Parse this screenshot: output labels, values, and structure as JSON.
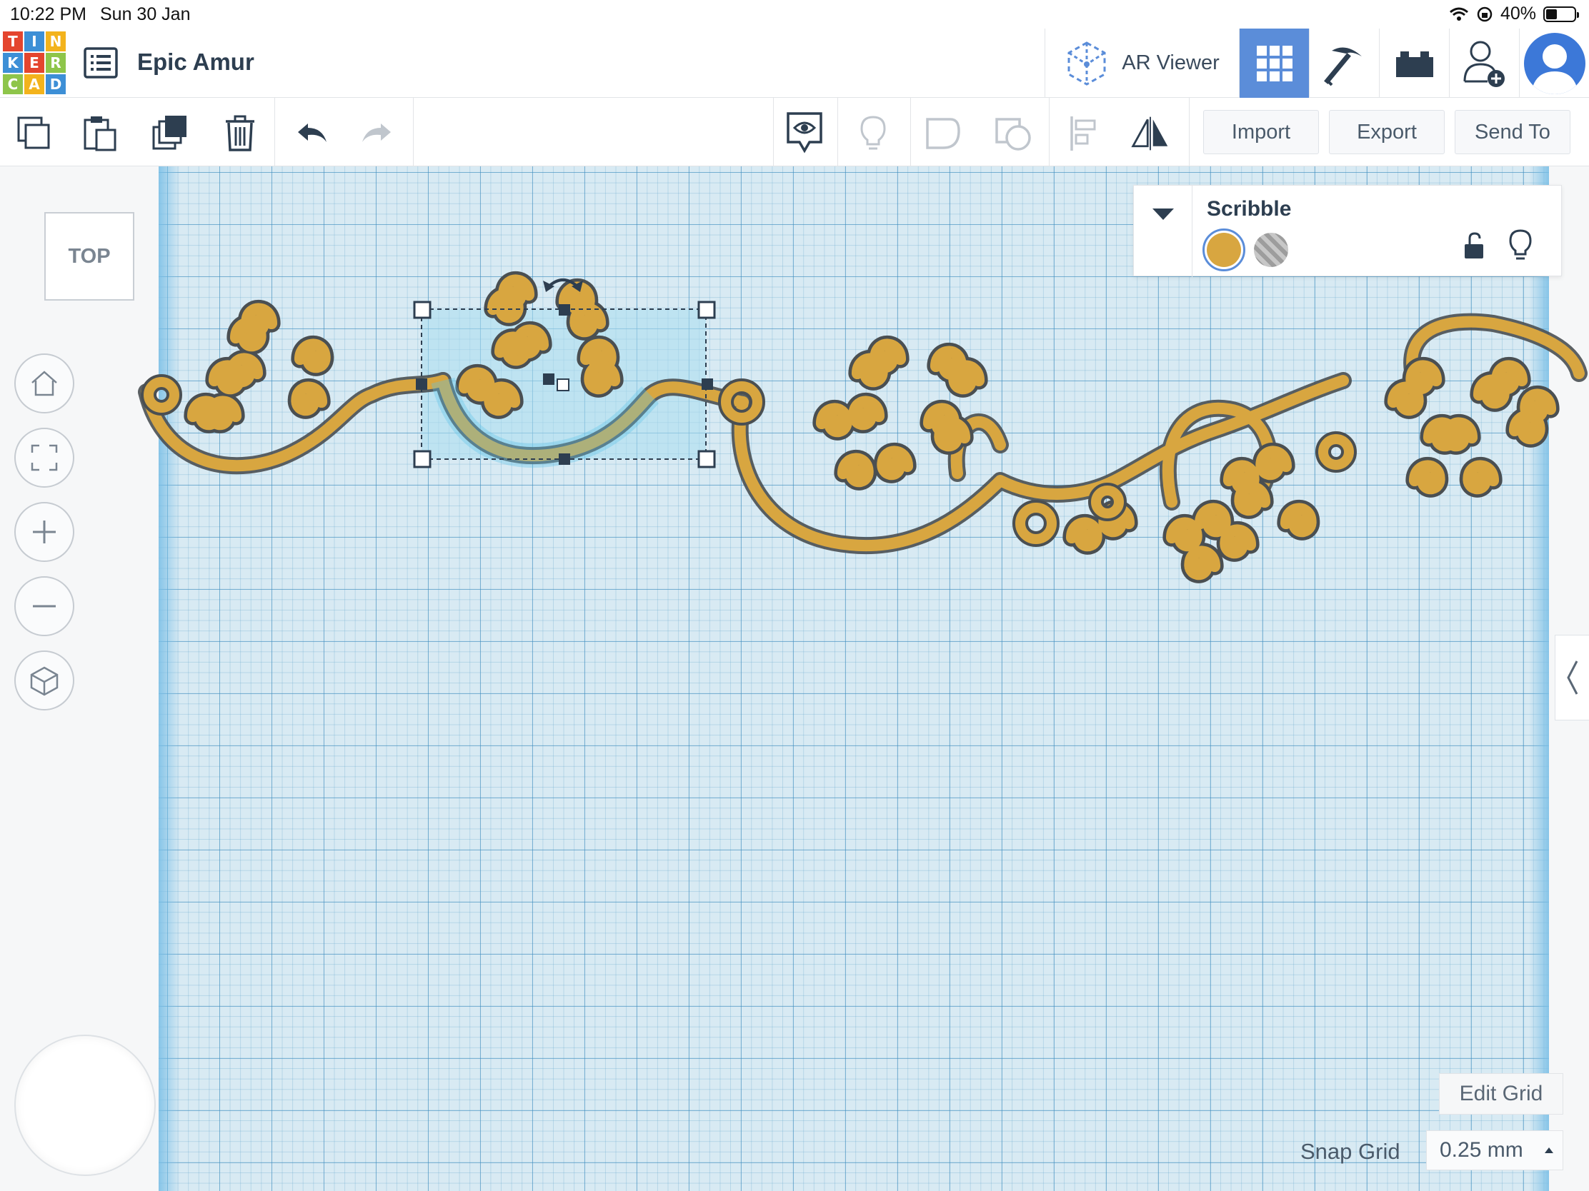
{
  "status_bar": {
    "time": "10:22 PM",
    "date": "Sun 30 Jan",
    "battery": "40%",
    "battery_level": 0.4
  },
  "app": {
    "logo_letters": [
      "T",
      "I",
      "N",
      "K",
      "E",
      "R",
      "C",
      "A",
      "D"
    ],
    "logo_colors": [
      "#e4452e",
      "#3d8fd6",
      "#f3b31c",
      "#3d8fd6",
      "#e4452e",
      "#8ec54a",
      "#8ec54a",
      "#f3b31c",
      "#3d8fd6"
    ],
    "project_name": "Epic Amur"
  },
  "top_right": {
    "ar_viewer_label": "AR Viewer",
    "views": [
      "grid-icon",
      "pickaxe-icon",
      "brick-icon"
    ],
    "active_view": "grid-icon"
  },
  "toolbar": {
    "tools": [
      "copy-icon",
      "paste-icon",
      "duplicate-icon",
      "trash-icon",
      "undo-icon",
      "redo-icon"
    ],
    "view_tools": [
      "notes-icon",
      "lightbulb-icon",
      "group-icon",
      "ungroup-icon",
      "align-icon",
      "mirror-icon"
    ],
    "import_label": "Import",
    "export_label": "Export",
    "send_to_label": "Send To"
  },
  "viewcube": {
    "label": "TOP"
  },
  "nav_controls": [
    "home-icon",
    "fit-view-icon",
    "zoom-in-icon",
    "zoom-out-icon",
    "perspective-icon"
  ],
  "inspector": {
    "title": "Scribble",
    "solid_color": "#d8a640",
    "hole_label": "hole-swatch"
  },
  "grid": {
    "edit_grid_label": "Edit Grid",
    "snap_grid_label": "Snap Grid",
    "snap_grid_value": "0.25 mm"
  },
  "colors": {
    "accent": "#5b8dd9",
    "shape": "#d8a640",
    "selection": "#5ec4e8",
    "grid": "#d8eaf3"
  }
}
